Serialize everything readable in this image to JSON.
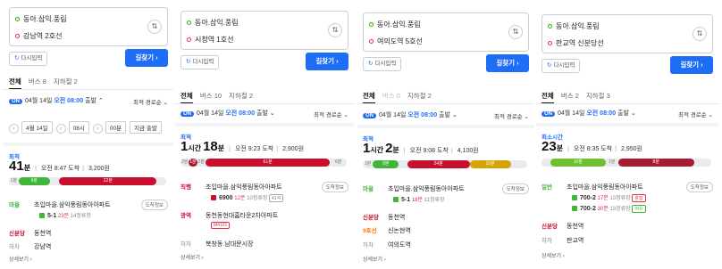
{
  "common": {
    "origin": "동아.삼익.풍림",
    "reload_label": "다시입력",
    "go_label": "길찾기",
    "sort_label": "최적 경로순",
    "depart_date": "04월 14일",
    "depart_time": "오전 08:00",
    "depart_suffix": "출발",
    "on_badge": "ON",
    "more_label": "상세보기",
    "tab_all": "전체"
  },
  "panels": [
    {
      "destination": "강남역 2호선",
      "tabs": [
        "전체",
        "버스 8",
        "지하철 2"
      ],
      "settings": {
        "date": "4월 14일",
        "hour": "08시",
        "minute": "00분",
        "now": "지금 출발"
      },
      "badge": "최적",
      "time_num": "41",
      "time_unit": "분",
      "arrival": "오전 8:47 도착",
      "fare": "3,200원",
      "segments": [
        {
          "label": "1분",
          "color": "walk",
          "share": 0.06
        },
        {
          "label": "9분",
          "color": "green",
          "share": 0.2
        },
        {
          "label": "",
          "color": "walk",
          "share": 0.06
        },
        {
          "label": "22분",
          "color": "red",
          "share": 0.62
        },
        {
          "label": "",
          "color": "walk",
          "share": 0.06
        }
      ],
      "steps": [
        {
          "kind": "마을",
          "name": "초입마을.삼익풍림동아아파트",
          "bus": "5-1",
          "eta": "23분",
          "stops": "14정류장",
          "info": "도착정보"
        },
        {
          "kind": "신분당",
          "name": "동천역"
        },
        {
          "kind": "하차",
          "name": "강남역"
        }
      ]
    },
    {
      "destination": "시청역 1호선",
      "tabs": [
        "전체",
        "버스 10",
        "지하철 2"
      ],
      "badge": "최적",
      "time_num": "1",
      "time_unit": "시간",
      "time_num2": "18",
      "time_unit2": "분",
      "arrival": "오전 9:23 도착",
      "fare": "2,900원",
      "segments": [
        {
          "label": "2분",
          "color": "walk",
          "share": 0.05
        },
        {
          "label": "1분",
          "color": "darkred",
          "share": 0.05
        },
        {
          "label": "2분",
          "color": "walk",
          "share": 0.05
        },
        {
          "label": "61분",
          "color": "red",
          "share": 0.75
        },
        {
          "label": "6분",
          "color": "walk",
          "share": 0.1
        }
      ],
      "steps": [
        {
          "kind": "직행",
          "name": "초입마을.삼익풍림동아아파트",
          "bus": "6900",
          "eta": "12분",
          "stops": "10정류장",
          "tag": "41석",
          "info": "도착정보"
        },
        {
          "kind": "광역",
          "name": "동천동현대홈타운2차아파트",
          "tag": "M4101"
        },
        {
          "kind": "하차",
          "name": "북창동.남대문시장"
        }
      ]
    },
    {
      "destination": "여의도역 5호선",
      "tabs": [
        "전체",
        "버스 0",
        "지하철 2"
      ],
      "badge": "최적",
      "time_num": "1",
      "time_unit": "시간",
      "time_num2": "2",
      "time_unit2": "분",
      "arrival": "오전 9:08 도착",
      "fare": "4,100원",
      "segments": [
        {
          "label": "1분",
          "color": "walk",
          "share": 0.06
        },
        {
          "label": "9분",
          "color": "green",
          "share": 0.16
        },
        {
          "label": "",
          "color": "walk",
          "share": 0.05
        },
        {
          "label": "24분",
          "color": "red",
          "share": 0.38
        },
        {
          "label": "16분",
          "color": "yellow",
          "share": 0.25
        },
        {
          "label": "",
          "color": "walk",
          "share": 0.1
        }
      ],
      "steps": [
        {
          "kind": "마을",
          "name": "초입마을.삼익풍림동아아파트",
          "bus": "5-1",
          "eta": "18분",
          "stops": "11정류장",
          "info": "도착정보"
        },
        {
          "kind": "신분당",
          "name": "동천역"
        },
        {
          "kind": "9호선",
          "name": "신논현역"
        },
        {
          "kind": "하차",
          "name": "여의도역"
        }
      ]
    },
    {
      "destination": "판교역 신분당선",
      "tabs": [
        "전체",
        "버스 2",
        "지하철 3"
      ],
      "badge": "최소시간",
      "time_num": "23",
      "time_unit": "분",
      "arrival": "오전 8:35 도착",
      "fare": "2,950원",
      "segments": [
        {
          "label": "",
          "color": "walk",
          "share": 0.05
        },
        {
          "label": "10분",
          "color": "lime",
          "share": 0.33
        },
        {
          "label": "1분",
          "color": "walk",
          "share": 0.07
        },
        {
          "label": "8분",
          "color": "darkred",
          "share": 0.45
        },
        {
          "label": "",
          "color": "walk",
          "share": 0.1
        }
      ],
      "steps": [
        {
          "kind": "일반",
          "name": "초입마을.삼익풍림동아아파트",
          "bus": "700-2",
          "eta": "17분",
          "stops": "13정류장",
          "tag": "혼잡",
          "bus2": "700-2",
          "eta2": "30분",
          "stops2": "13정류장",
          "tag2": "여유",
          "info": "도착정보"
        },
        {
          "kind": "신분당",
          "name": "동천역"
        },
        {
          "kind": "하차",
          "name": "판교역"
        }
      ]
    }
  ]
}
